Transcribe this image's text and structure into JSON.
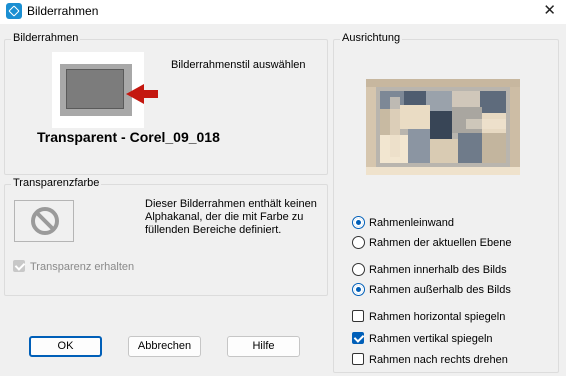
{
  "window": {
    "title": "Bilderrahmen",
    "close": "✕"
  },
  "frame_group": {
    "label": "Bilderrahmen",
    "select_label": "Bilderrahmenstil auswählen",
    "frame_name": "Transparent - Corel_09_018"
  },
  "transparency_group": {
    "label": "Transparenzfarbe",
    "alpha_text": "Dieser Bilderrahmen enthält keinen Alphakanal, der die mit Farbe zu füllenden Bereiche definiert.",
    "keep_transparency": {
      "label": "Transparenz erhalten",
      "checked": true,
      "enabled": false
    }
  },
  "orientation_group": {
    "label": "Ausrichtung",
    "radios_a": [
      {
        "label": "Rahmenleinwand",
        "checked": true
      },
      {
        "label": "Rahmen der aktuellen Ebene",
        "checked": false
      }
    ],
    "radios_b": [
      {
        "label": "Rahmen innerhalb des Bilds",
        "checked": false
      },
      {
        "label": "Rahmen außerhalb des Bilds",
        "checked": true
      }
    ],
    "checks": [
      {
        "label": "Rahmen horizontal spiegeln",
        "checked": false
      },
      {
        "label": "Rahmen vertikal spiegeln",
        "checked": true
      },
      {
        "label": "Rahmen nach rechts drehen",
        "checked": false
      }
    ]
  },
  "buttons": {
    "ok": "OK",
    "cancel": "Abbrechen",
    "help": "Hilfe"
  },
  "colors": {
    "accent": "#005fb8",
    "arrow": "#c4170f",
    "app_icon": "#1b8fd2"
  }
}
